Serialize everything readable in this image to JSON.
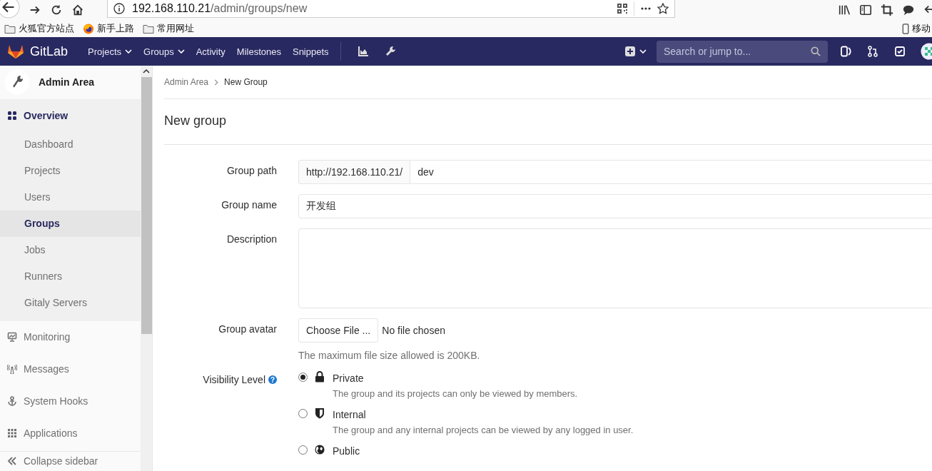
{
  "browser": {
    "url_host": "192.168.110.21",
    "url_path": "/admin/groups/new",
    "bookmarks": [
      {
        "label": "火狐官方站点",
        "kind": "folder"
      },
      {
        "label": "新手上路",
        "kind": "firefox"
      },
      {
        "label": "常用网址",
        "kind": "folder"
      }
    ],
    "mobile_bookmark": "移动"
  },
  "navbar": {
    "logo": "GitLab",
    "links": [
      {
        "label": "Projects",
        "dropdown": true
      },
      {
        "label": "Groups",
        "dropdown": true
      },
      {
        "label": "Activity",
        "dropdown": false
      },
      {
        "label": "Milestones",
        "dropdown": false
      },
      {
        "label": "Snippets",
        "dropdown": false
      }
    ],
    "search_placeholder": "Search or jump to..."
  },
  "sidebar": {
    "title": "Admin Area",
    "sections": [
      {
        "label": "Overview",
        "selected": true,
        "children": [
          {
            "label": "Dashboard",
            "selected": false
          },
          {
            "label": "Projects",
            "selected": false
          },
          {
            "label": "Users",
            "selected": false
          },
          {
            "label": "Groups",
            "selected": true
          },
          {
            "label": "Jobs",
            "selected": false
          },
          {
            "label": "Runners",
            "selected": false
          },
          {
            "label": "Gitaly Servers",
            "selected": false
          }
        ]
      },
      {
        "label": "Monitoring",
        "selected": false
      },
      {
        "label": "Messages",
        "selected": false
      },
      {
        "label": "System Hooks",
        "selected": false
      },
      {
        "label": "Applications",
        "selected": false
      }
    ],
    "collapse": "Collapse sidebar"
  },
  "breadcrumb": [
    "Admin Area",
    "New Group"
  ],
  "title": "New group",
  "form": {
    "path_label": "Group path",
    "path_prefix": "http://192.168.110.21/",
    "path_value": "dev",
    "name_label": "Group name",
    "name_value": "开发组",
    "description_label": "Description",
    "avatar_label": "Group avatar",
    "choose_file": "Choose File ...",
    "no_file": "No file chosen",
    "avatar_hint": "The maximum file size allowed is 200KB.",
    "visibility_label": "Visibility Level",
    "visibility_help": "?",
    "visibility_options": [
      {
        "label": "Private",
        "description": "The group and its projects can only be viewed by members.",
        "selected": true
      },
      {
        "label": "Internal",
        "description": "The group and any internal projects can be viewed by any logged in user.",
        "selected": false
      },
      {
        "label": "Public",
        "selected": false
      }
    ]
  }
}
